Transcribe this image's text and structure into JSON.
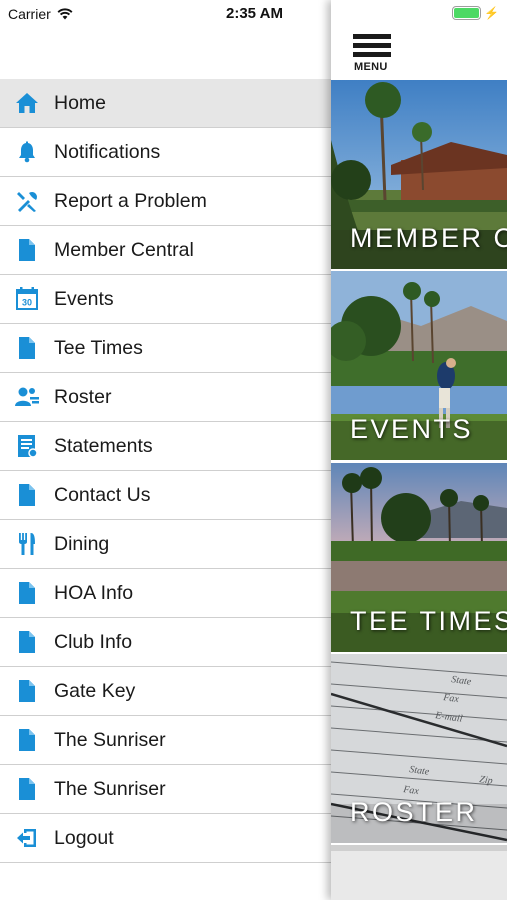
{
  "status_bar": {
    "carrier": "Carrier",
    "time": "2:35 AM"
  },
  "menu_button": {
    "label": "MENU"
  },
  "menu": {
    "items": [
      {
        "label": "Home",
        "icon": "home-icon",
        "active": true
      },
      {
        "label": "Notifications",
        "icon": "bell-icon"
      },
      {
        "label": "Report a Problem",
        "icon": "tools-icon"
      },
      {
        "label": "Member Central",
        "icon": "document-icon"
      },
      {
        "label": "Events",
        "icon": "calendar-icon",
        "icon_text": "30"
      },
      {
        "label": "Tee Times",
        "icon": "document-icon"
      },
      {
        "label": "Roster",
        "icon": "people-icon"
      },
      {
        "label": "Statements",
        "icon": "statement-icon"
      },
      {
        "label": "Contact Us",
        "icon": "document-icon"
      },
      {
        "label": "Dining",
        "icon": "fork-knife-icon"
      },
      {
        "label": "HOA Info",
        "icon": "document-icon"
      },
      {
        "label": "Club Info",
        "icon": "document-icon"
      },
      {
        "label": "Gate Key",
        "icon": "document-icon"
      },
      {
        "label": "The Sunriser",
        "icon": "document-icon"
      },
      {
        "label": "The Sunriser",
        "icon": "document-icon"
      },
      {
        "label": "Logout",
        "icon": "logout-icon"
      }
    ]
  },
  "tiles": [
    {
      "label": "MEMBER CENTRAL"
    },
    {
      "label": "EVENTS"
    },
    {
      "label": "TEE TIMES"
    },
    {
      "label": "ROSTER"
    }
  ],
  "colors": {
    "accent": "#1a8fd6",
    "active_row": "#e6e6e6",
    "divider": "#cfcfcf"
  }
}
